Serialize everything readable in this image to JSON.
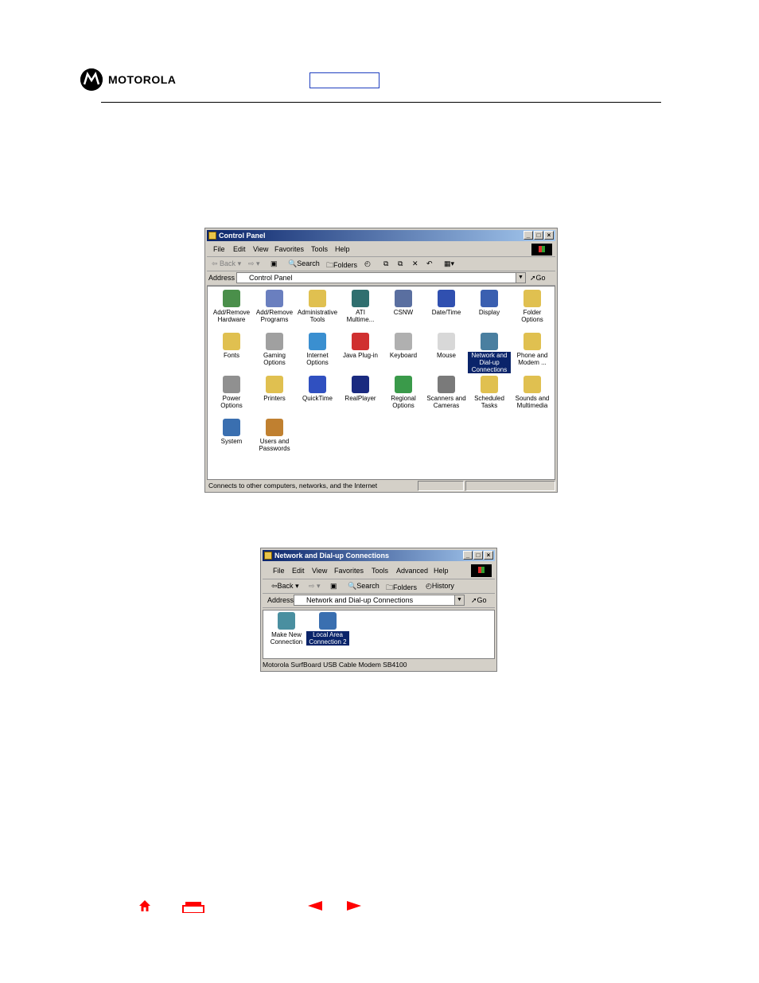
{
  "header": {
    "brand": "MOTOROLA"
  },
  "control_panel": {
    "title": "Control Panel",
    "menu": [
      "File",
      "Edit",
      "View",
      "Favorites",
      "Tools",
      "Help"
    ],
    "toolbar": {
      "back": "Back",
      "search": "Search",
      "folders": "Folders"
    },
    "address_label": "Address",
    "address_value": "Control Panel",
    "go": "Go",
    "icons": [
      {
        "l1": "Add/Remove",
        "l2": "Hardware",
        "color": "#4a8f4a"
      },
      {
        "l1": "Add/Remove",
        "l2": "Programs",
        "color": "#6a7fbf"
      },
      {
        "l1": "Administrative",
        "l2": "Tools",
        "color": "#e0c050"
      },
      {
        "l1": "ATI",
        "l2": "Multime...",
        "color": "#2f6f6f"
      },
      {
        "l1": "CSNW",
        "l2": "",
        "color": "#5a6fa0"
      },
      {
        "l1": "Date/Time",
        "l2": "",
        "color": "#3050b0"
      },
      {
        "l1": "Display",
        "l2": "",
        "color": "#3a5fb0"
      },
      {
        "l1": "Folder",
        "l2": "Options",
        "color": "#e0c050"
      },
      {
        "l1": "Fonts",
        "l2": "",
        "color": "#e0c050"
      },
      {
        "l1": "Gaming",
        "l2": "Options",
        "color": "#a0a0a0"
      },
      {
        "l1": "Internet",
        "l2": "Options",
        "color": "#3a8fd0"
      },
      {
        "l1": "Java Plug-in",
        "l2": "",
        "color": "#d03030"
      },
      {
        "l1": "Keyboard",
        "l2": "",
        "color": "#b0b0b0"
      },
      {
        "l1": "Mouse",
        "l2": "",
        "color": "#d8d8d8"
      },
      {
        "l1": "Network and",
        "l2": "Dial-up",
        "l3": "Connections",
        "color": "#4a7fa0",
        "selected": true
      },
      {
        "l1": "Phone and",
        "l2": "Modem ...",
        "color": "#e0c050"
      },
      {
        "l1": "Power",
        "l2": "Options",
        "color": "#909090"
      },
      {
        "l1": "Printers",
        "l2": "",
        "color": "#e0c050"
      },
      {
        "l1": "QuickTime",
        "l2": "",
        "color": "#3050c0"
      },
      {
        "l1": "RealPlayer",
        "l2": "",
        "color": "#1a2a80"
      },
      {
        "l1": "Regional",
        "l2": "Options",
        "color": "#3a9a4a"
      },
      {
        "l1": "Scanners and",
        "l2": "Cameras",
        "color": "#7a7a7a"
      },
      {
        "l1": "Scheduled",
        "l2": "Tasks",
        "color": "#e0c050"
      },
      {
        "l1": "Sounds and",
        "l2": "Multimedia",
        "color": "#e0c050"
      },
      {
        "l1": "System",
        "l2": "",
        "color": "#3a6fb0"
      },
      {
        "l1": "Users and",
        "l2": "Passwords",
        "color": "#c08030"
      }
    ],
    "status": "Connects to other computers, networks, and the Internet"
  },
  "network_window": {
    "title": "Network and Dial-up Connections",
    "menu": [
      "File",
      "Edit",
      "View",
      "Favorites",
      "Tools",
      "Advanced",
      "Help"
    ],
    "toolbar": {
      "back": "Back",
      "search": "Search",
      "folders": "Folders",
      "history": "History"
    },
    "address_label": "Address",
    "address_value": "Network and Dial-up Connections",
    "go": "Go",
    "icons": [
      {
        "l1": "Make New",
        "l2": "Connection",
        "color": "#4a8fa0"
      },
      {
        "l1": "Local Area",
        "l2": "Connection 2",
        "color": "#3a6fb0",
        "selected": true
      }
    ],
    "status": "Motorola SurfBoard USB Cable Modem SB4100"
  },
  "colors": {
    "nav_red": "#ff0000",
    "title_blue": "#0a246a"
  }
}
